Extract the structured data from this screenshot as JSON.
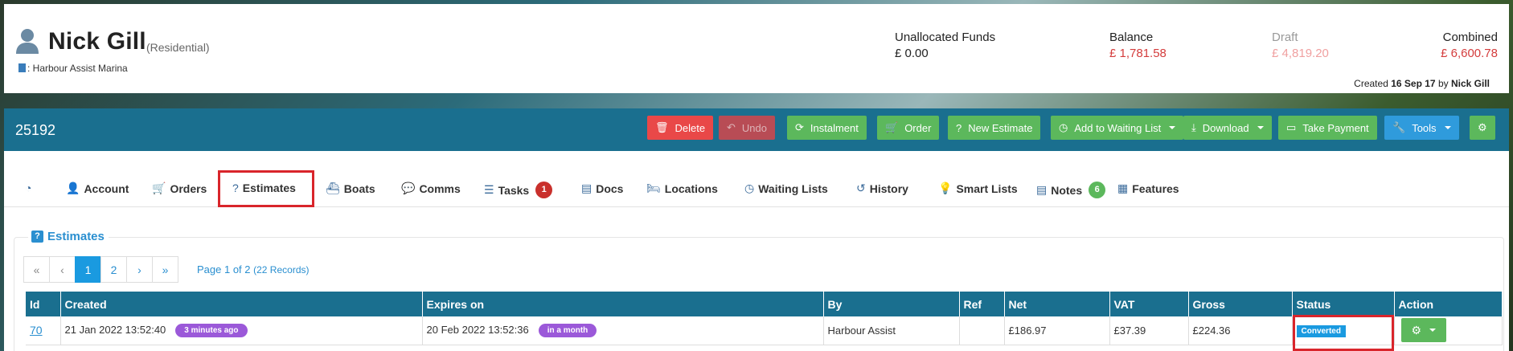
{
  "customer": {
    "name": "Nick Gill",
    "type": "(Residential)",
    "marina": ": Harbour Assist Marina"
  },
  "funds": {
    "unallocated_label": "Unallocated Funds",
    "unallocated_value": "£ 0.00",
    "balance_label": "Balance",
    "balance_value": "£ 1,781.58",
    "draft_label": "Draft",
    "draft_value": "£ 4,819.20",
    "combined_label": "Combined",
    "combined_value": "£ 6,600.78"
  },
  "created": {
    "prefix": "Created",
    "date": "16 Sep 17",
    "by": "by",
    "user": "Nick Gill"
  },
  "toolbar": {
    "account_id": "25192",
    "delete": "Delete",
    "undo": "Undo",
    "instalment": "Instalment",
    "order": "Order",
    "new_estimate": "New Estimate",
    "add_waiting": "Add to Waiting List",
    "download": "Download",
    "take_payment": "Take Payment",
    "tools": "Tools"
  },
  "tabs": {
    "account": "Account",
    "orders": "Orders",
    "estimates": "Estimates",
    "boats": "Boats",
    "comms": "Comms",
    "tasks": "Tasks",
    "tasks_count": "1",
    "docs": "Docs",
    "locations": "Locations",
    "waiting": "Waiting Lists",
    "history": "History",
    "smart": "Smart Lists",
    "notes": "Notes",
    "notes_count": "6",
    "features": "Features"
  },
  "section": {
    "title": "Estimates"
  },
  "pager": {
    "first": "«",
    "prev": "‹",
    "p1": "1",
    "p2": "2",
    "next": "›",
    "last": "»",
    "info": "Page 1 of 2",
    "records": "(22 Records)"
  },
  "table": {
    "headers": [
      "Id",
      "Created",
      "Expires on",
      "By",
      "Ref",
      "Net",
      "VAT",
      "Gross",
      "Status",
      "Action"
    ],
    "rows": [
      {
        "id": "70",
        "created": "21 Jan 2022 13:52:40",
        "created_rel": "3 minutes ago",
        "expires": "20 Feb 2022 13:52:36",
        "expires_rel": "in a month",
        "by": "Harbour Assist",
        "ref": "",
        "net": "£186.97",
        "vat": "£37.39",
        "gross": "£224.36",
        "status": "Converted"
      }
    ]
  },
  "colors": {
    "primary_bar": "#1a6f8f",
    "danger": "#e94848",
    "success": "#5cb85c",
    "info": "#2f9bdc",
    "highlight": "#d9252b"
  }
}
